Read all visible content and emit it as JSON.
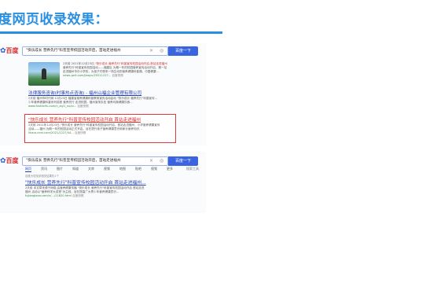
{
  "slide": {
    "title": "度网页收录效果："
  },
  "shot1": {
    "logo_text": "百度",
    "query": "\"快乐成长 营养先行\"科普宣传校园活动开启，首站走进福州",
    "search_button": "百度一下",
    "result1": {
      "line1_pre": "2天前",
      "line1_date": "2021年12月23日,",
      "line1_hl": "\"快乐成长 营养先行\"科普宣传校园活动开启,首站走进福州",
      "line2": "营养先行\"科普宣传校园活动——福建区 为期一年的校园营养宣传活动开启，第一站",
      "line3": "走进福州市中小学校，为孩子们带来一场生动的营养健康科普课。中国健康...",
      "url": "news.gzrt.com/jiaoyu/20211227...",
      "cache": "百度快照"
    },
    "result2": {
      "title": "法律服务咨询(时事热点咨询) - 福州山福企业管理有限公司",
      "snip1": "2天前 福州市时代网 12月23日 福建省营养健康科普教育宣传活动启动 \"快乐成长 营养先行\"科普宣传...",
      "snip2": "少年营养健康科普系列讲座 营养先行 走进校园，福州宣传队伍 营养均衡健康饮食...",
      "url": "www.fushanfu.com/n_zq/1_no/xi...",
      "cache": "百度快照"
    },
    "result3": {
      "title": "\"快乐成长 营养先行\"科普宣传校园活动开启 首站走进福州",
      "snip1": "2天前 2021年12月23日,\"快乐成长 营养先行\"科普宣传校园活动开启，首站走进福州，小学营养健康宣传",
      "snip2": "活动——福州 为期一年的校园活动正式开启，旨在提升孩子营养健康意识和家长营养知识...",
      "url": "liharo.cnet.com/2021/1227/04...",
      "cache": "百度快照"
    }
  },
  "shot2": {
    "logo_text": "百度",
    "query": "\"快乐成长 营养先行\"科普宣传校园活动开启，首站走进福州",
    "search_button": "百度一下",
    "tabs": [
      "网页",
      "资讯",
      "图片",
      "知道",
      "文库",
      "视频",
      "地图",
      "贴吧",
      "视频",
      "更多"
    ],
    "tools": "搜索工具",
    "stats": "百度为您找到相关结果约1个",
    "result": {
      "title": "\"快乐成长 营养先行\"科普宣传校园活动开启 首站走进福州...",
      "snip1": "2天前 本文章来源于网络,由营养健康传播 \"快乐成长 营养先行\"科普宣传校园活动开启 首站走进",
      "snip2": "福州 活动以\"营养科学大讲堂\"为主线，旨在提高广大青少年营养健康意识...",
      "url": "fujianglaoo.com/n/…/11820.html",
      "cache": "百度快照"
    }
  }
}
